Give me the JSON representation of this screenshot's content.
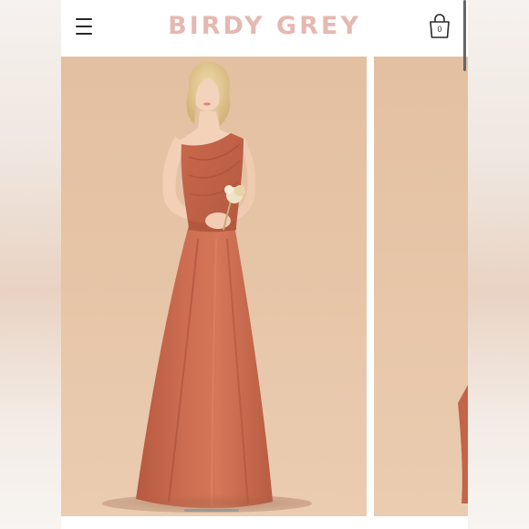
{
  "header": {
    "brand": "BIRDY GREY",
    "cart_count": "0",
    "menu_icon": "hamburger-menu-icon",
    "cart_icon": "shopping-bag-icon"
  },
  "gallery": {
    "main_image": "model-in-terracotta-one-shoulder-gown-photo",
    "next_image": "partial-next-product-photo"
  },
  "colors": {
    "brand": "#e6b8b2",
    "dress": "#c8684d",
    "backdrop": "#e6c4a6"
  }
}
